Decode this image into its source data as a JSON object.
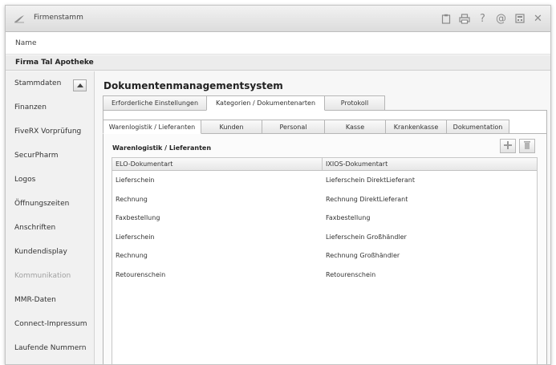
{
  "window": {
    "title": "Firmenstamm",
    "toolbar_icons": [
      "clipboard-icon",
      "printer-icon",
      "help-icon",
      "at-icon",
      "calculator-icon",
      "close-icon"
    ],
    "toolbar_glyphs": [
      "?",
      "@",
      "✕"
    ]
  },
  "header": {
    "name_label": "Name",
    "firma": "Firma Tal Apotheke"
  },
  "sidebar": {
    "items": [
      {
        "label": "Stammdaten",
        "enabled": true
      },
      {
        "label": "Finanzen",
        "enabled": true
      },
      {
        "label": "FiveRX Vorprüfung",
        "enabled": true
      },
      {
        "label": "SecurPharm",
        "enabled": true
      },
      {
        "label": "Logos",
        "enabled": true
      },
      {
        "label": "Öffnungszeiten",
        "enabled": true
      },
      {
        "label": "Anschriften",
        "enabled": true
      },
      {
        "label": "Kundendisplay",
        "enabled": true
      },
      {
        "label": "Kommunikation",
        "enabled": false
      },
      {
        "label": "MMR-Daten",
        "enabled": true
      },
      {
        "label": "Connect-Impressum",
        "enabled": true
      },
      {
        "label": "Laufende Nummern",
        "enabled": true
      }
    ]
  },
  "main": {
    "heading": "Dokumentenmanagementsystem",
    "tabs_level1": [
      {
        "label": "Erforderliche Einstellungen",
        "active": false
      },
      {
        "label": "Kategorien / Dokumentenarten",
        "active": true
      },
      {
        "label": "Protokoll",
        "active": false
      }
    ],
    "tabs_level2": [
      {
        "label": "Warenlogistik / Lieferanten",
        "active": true
      },
      {
        "label": "Kunden",
        "active": false
      },
      {
        "label": "Personal",
        "active": false
      },
      {
        "label": "Kasse",
        "active": false
      },
      {
        "label": "Krankenkasse",
        "active": false
      },
      {
        "label": "Dokumentation",
        "active": false
      }
    ],
    "panel_title": "Warenlogistik / Lieferanten",
    "toolbar": {
      "add_icon": "add-icon",
      "delete_icon": "delete-icon"
    },
    "table": {
      "columns": [
        "ELO-Dokumentart",
        "IXIOS-Dokumentart"
      ],
      "rows": [
        [
          "Lieferschein",
          "Lieferschein DirektLieferant"
        ],
        [
          "Rechnung",
          "Rechnung DirektLieferant"
        ],
        [
          "Faxbestellung",
          "Faxbestellung"
        ],
        [
          "Lieferschein",
          "Lieferschein Großhändler"
        ],
        [
          "Rechnung",
          "Rechnung Großhändler"
        ],
        [
          "Retourenschein",
          "Retourenschein"
        ]
      ]
    }
  },
  "colors": {
    "titlebar": "#dcdcdc",
    "panel_bg": "#ffffff",
    "border": "#b6b6b6",
    "disabled_text": "#a0a0a0"
  }
}
